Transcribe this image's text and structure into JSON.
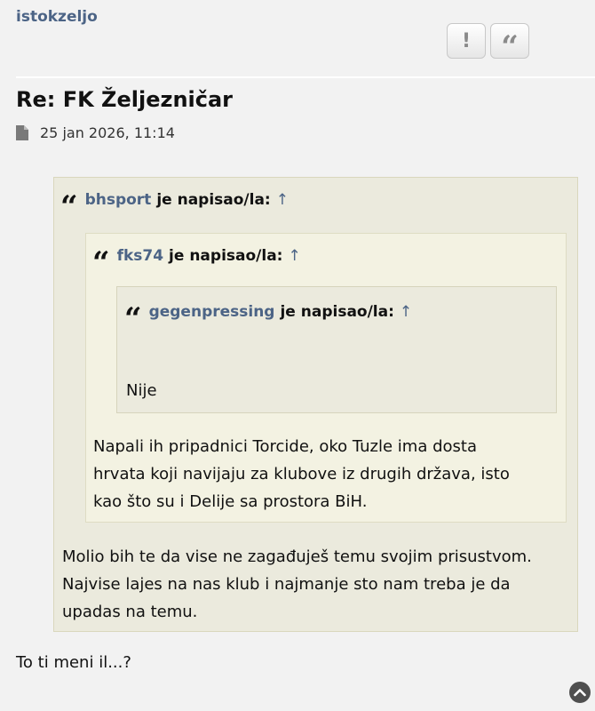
{
  "post": {
    "author": "istokzeljo",
    "title": "Re: FK Željezničar",
    "date": "25 jan 2026, 11:14",
    "buttons": {
      "report": "!",
      "quote": "“"
    },
    "body": "To ti meni il...?"
  },
  "quotes": {
    "outer": {
      "user": "bhsport",
      "wrote": "je napisao/la:",
      "arrow": "↑",
      "text_lines": [
        "Molio bih te da vise ne zagađuješ temu svojim prisustvom.",
        "Najvise lajes na nas klub i najmanje sto nam treba je da",
        "upadas na temu."
      ]
    },
    "middle": {
      "user": "fks74",
      "wrote": "je napisao/la:",
      "arrow": "↑",
      "text_lines": [
        "Napali ih pripadnici Torcide, oko Tuzle ima dosta",
        "hrvata koji navijaju za klubove iz drugih država, isto",
        "kao što su i Delije sa prostora BiH."
      ]
    },
    "inner": {
      "user": "gegenpressing",
      "wrote": "je napisao/la:",
      "arrow": "↑",
      "text": "Nije"
    }
  },
  "icons": {
    "date": "document-icon",
    "quote": "quote-icon",
    "scroll": "chevron-up-icon"
  }
}
